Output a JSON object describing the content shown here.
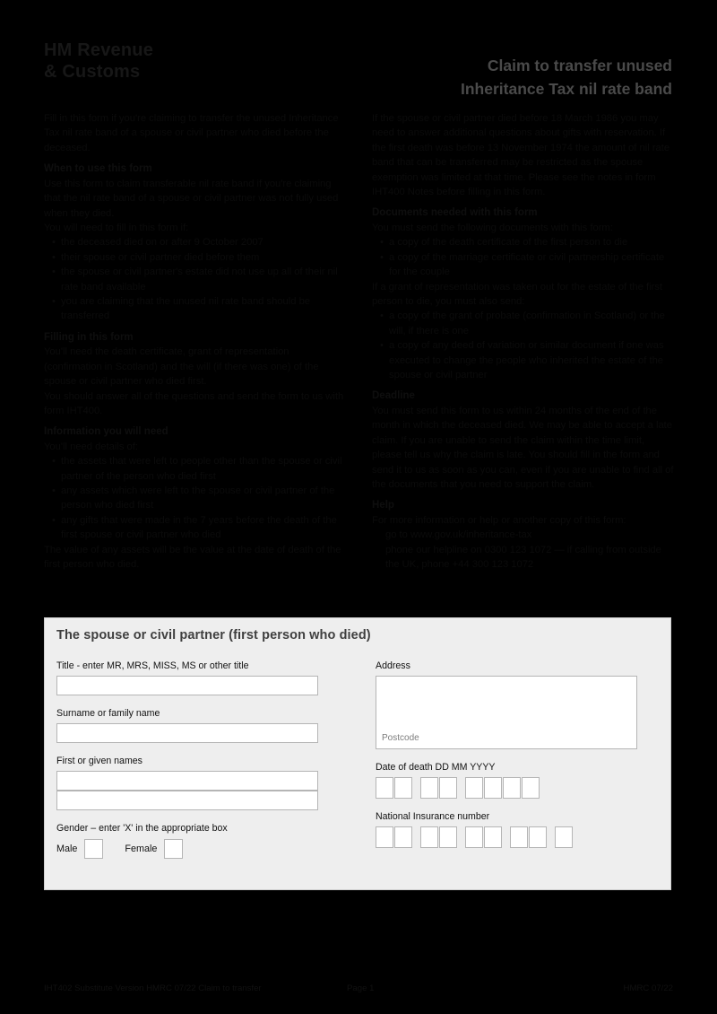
{
  "header": {
    "logo": "HM Revenue\n& Customs",
    "title": "Claim to transfer unused\nInheritance Tax nil rate band"
  },
  "intro": {
    "left": [
      {
        "type": "p",
        "text": "Fill in this form if you're claiming to transfer the unused Inheritance Tax nil rate band of a spouse or civil partner who died before the deceased."
      },
      {
        "type": "h",
        "text": "When to use this form"
      },
      {
        "type": "p",
        "text": "Use this form to claim transferable nil rate band if you're claiming that the nil rate band of a spouse or civil partner was not fully used when they died."
      },
      {
        "type": "p",
        "text": "You will need to fill in this form if:"
      },
      {
        "type": "bullets",
        "items": [
          "the deceased died on or after 9 October 2007",
          "their spouse or civil partner died before them",
          "the spouse or civil partner's estate did not use up all of their nil rate band available",
          "you are claiming that the unused nil rate band should be transferred"
        ]
      },
      {
        "type": "h",
        "text": "Filling in this form"
      },
      {
        "type": "p",
        "text": "You'll need the death certificate, grant of representation (confirmation in Scotland) and the will (if there was one) of the spouse or civil partner who died first."
      },
      {
        "type": "p",
        "text": "You should answer all of the questions and send the form to us with form IHT400."
      },
      {
        "type": "h",
        "text": "Information you will need"
      },
      {
        "type": "p",
        "text": "You'll need details of:"
      },
      {
        "type": "bullets",
        "items": [
          "the assets that were left to people other than the spouse or civil partner of the person who died first",
          "any assets which were left to the spouse or civil partner of the person who died first",
          "any gifts that were made in the 7 years before the death of the first spouse or civil partner who died"
        ]
      },
      {
        "type": "p",
        "text": "The value of any assets will be the value at the date of death of the first person who died."
      }
    ],
    "right": [
      {
        "type": "p",
        "text": "If the spouse or civil partner died before 18 March 1986 you may need to answer additional questions about gifts with reservation. If the first death was before 13 November 1974 the amount of nil rate band that can be transferred may be restricted as the spouse exemption was limited at that time. Please see the notes in form IHT400 Notes before filling in this form."
      },
      {
        "type": "h",
        "text": "Documents needed with this form"
      },
      {
        "type": "p",
        "text": "You must send the following documents with this form:"
      },
      {
        "type": "bullets",
        "items": [
          "a copy of the death certificate of the first person to die",
          "a copy of the marriage certificate or civil partnership certificate for the couple"
        ]
      },
      {
        "type": "p",
        "text": "If a grant of representation was taken out for the estate of the first person to die, you must also send:"
      },
      {
        "type": "bullets",
        "items": [
          "a copy of the grant of probate (confirmation in Scotland) or the will, if there is one",
          "a copy of any deed of variation or similar document if one was executed to change the people who inherited the estate of the spouse or civil partner"
        ]
      },
      {
        "type": "h",
        "text": "Deadline"
      },
      {
        "type": "p",
        "text": "You must send this form to us within 24 months of the end of the month in which the deceased died. We may be able to accept a late claim. If you are unable to send the claim within the time limit, please tell us why the claim is late. You should fill in the form and send it to us as soon as you can, even if you are unable to find all of the documents that you need to support the claim."
      },
      {
        "type": "h",
        "text": "Help"
      },
      {
        "type": "p",
        "text": "For more information or help or another copy of this form:"
      },
      {
        "type": "bullets",
        "plain": true,
        "items": [
          "go to www.gov.uk/inheritance-tax",
          "phone our helpline on 0300 123 1072 — if calling from outside the UK, phone +44 300 123 1072"
        ]
      }
    ]
  },
  "form": {
    "title": "The spouse or civil partner (first person who died)",
    "title_label": "Title - enter MR, MRS, MISS, MS or other title",
    "surname_label": "Surname or family name",
    "firstnames_label": "First or given names",
    "gender_label": "Gender – enter 'X' in the appropriate box",
    "male_label": "Male",
    "female_label": "Female",
    "address_label": "Address",
    "postcode_label": "Postcode",
    "dod_label": "Date of death  DD MM YYYY",
    "ni_label": "National Insurance number",
    "title_value": "",
    "surname_value": "",
    "firstnames_value_1": "",
    "firstnames_value_2": "",
    "address_value": ""
  },
  "footer": {
    "left": "IHT402  Substitute Version  HMRC 07/22  Claim to transfer",
    "page": "Page 1",
    "right": "HMRC 07/22"
  },
  "colors": {
    "page_bg": "#000000",
    "panel_bg": "#eeeeee",
    "field_bg": "#ffffff",
    "field_border": "#b5b5b5",
    "title_text": "#4a4a4a"
  }
}
